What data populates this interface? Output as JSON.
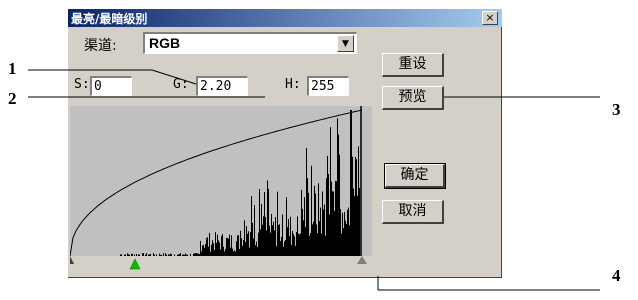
{
  "dialog": {
    "title": "最亮/最暗级别",
    "close_label": "×",
    "channel_label": "渠道:",
    "channel_value": "RGB",
    "dropdown_arrow": "▼",
    "s_label": "S:",
    "s_value": "0",
    "g_label": "G:",
    "g_value": "2.20",
    "h_label": "H:",
    "h_value": "255",
    "buttons": {
      "reset": "重设",
      "preview": "预览",
      "ok": "确定",
      "cancel": "取消"
    },
    "icons": [
      "close-icon",
      "dropdown-arrow-icon",
      "black-point-slider-icon",
      "gamma-slider-icon",
      "white-point-slider-icon"
    ],
    "colors": {
      "title_bar": "#0a246a",
      "dialog_bg": "#d4d0c8",
      "histogram_bg": "#c0c0c0",
      "gamma_slider": "#00c000"
    }
  },
  "callouts": [
    "1",
    "2",
    "3",
    "4"
  ]
}
